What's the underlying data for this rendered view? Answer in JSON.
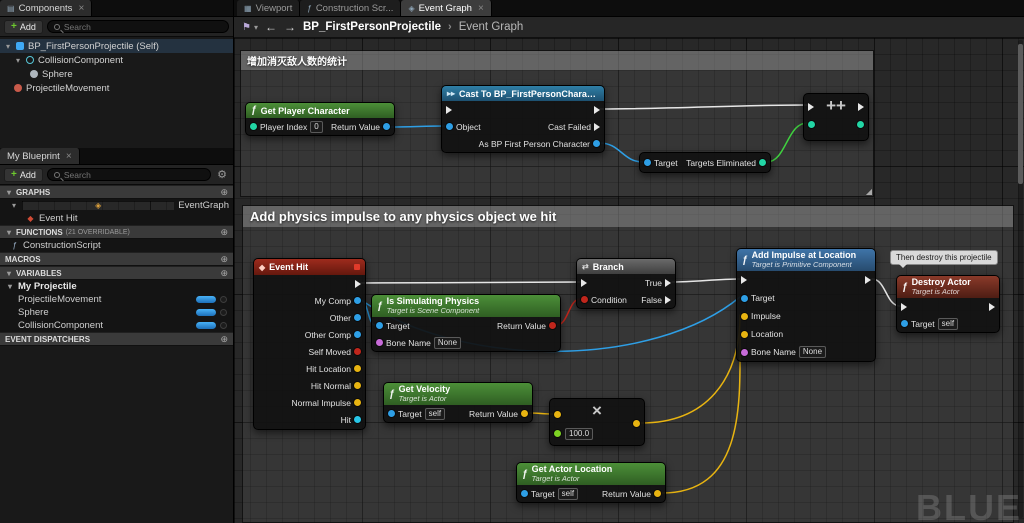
{
  "icons": {
    "components": "▤",
    "viewport": "▦",
    "graph": "◈",
    "close": "×",
    "caret_down": "▾",
    "caret_right": "▸",
    "add_circle": "⊕",
    "gear": "⚙",
    "function": "ƒ",
    "event_diamond": "◆",
    "branch": "⇄",
    "cast": "▸▸",
    "bookmark": "⚑",
    "back_arrow": "←",
    "forward_arrow": "→",
    "resize": "◢"
  },
  "components_panel": {
    "tab_label": "Components",
    "add_label": "Add",
    "search_placeholder": "Search",
    "items": [
      {
        "label": "BP_FirstPersonProjectile (Self)"
      },
      {
        "label": "CollisionComponent"
      },
      {
        "label": "Sphere"
      },
      {
        "label": "ProjectileMovement"
      }
    ]
  },
  "my_blueprint": {
    "tab_label": "My Blueprint",
    "add_label": "Add",
    "search_placeholder": "Search",
    "sections": {
      "graphs": "GRAPHS",
      "functions": "FUNCTIONS",
      "functions_badge": "(21 OVERRIDABLE)",
      "macros": "MACROS",
      "variables": "VARIABLES",
      "event_dispatchers": "EVENT DISPATCHERS"
    },
    "graph_items": [
      {
        "label": "EventGraph"
      },
      {
        "label": "Event Hit"
      }
    ],
    "function_items": [
      {
        "label": "ConstructionScript"
      }
    ],
    "variable_category": "My Projectile",
    "variable_items": [
      {
        "label": "ProjectileMovement"
      },
      {
        "label": "Sphere"
      },
      {
        "label": "CollisionComponent"
      }
    ]
  },
  "editor_tabs": [
    {
      "label": "Viewport"
    },
    {
      "label": "Construction Scr..."
    },
    {
      "label": "Event Graph"
    }
  ],
  "breadcrumb": {
    "root": "BP_FirstPersonProjectile",
    "separator": "›",
    "current": "Event Graph"
  },
  "comments": {
    "stats_title": "增加消灭敌人数的统计",
    "physics_title": "Add physics impulse to any physics object we hit",
    "bubble": "Then destroy this projectile"
  },
  "nodes": {
    "get_player_character": {
      "title": "Get Player Character",
      "player_index_label": "Player Index",
      "player_index_value": "0",
      "return_label": "Return Value"
    },
    "cast_to_character": {
      "title": "Cast To BP_FirstPersonCharacter",
      "object_label": "Object",
      "cast_failed_label": "Cast Failed",
      "as_label": "As BP First Person Character"
    },
    "increment": {
      "symbol": "++"
    },
    "targets_eliminated": {
      "target_label": "Target",
      "value_label": "Targets Eliminated"
    },
    "event_hit": {
      "title": "Event Hit",
      "pin_labels": [
        "My Comp",
        "Other",
        "Other Comp",
        "Self Moved",
        "Hit Location",
        "Hit Normal",
        "Normal Impulse",
        "Hit"
      ]
    },
    "is_simulating_physics": {
      "title": "Is Simulating Physics",
      "subtitle": "Target is Scene Component",
      "target_label": "Target",
      "bone_label": "Bone Name",
      "bone_value": "None",
      "return_label": "Return Value"
    },
    "branch": {
      "title": "Branch",
      "condition_label": "Condition",
      "true_label": "True",
      "false_label": "False"
    },
    "get_velocity": {
      "title": "Get Velocity",
      "subtitle": "Target is Actor",
      "target_label": "Target",
      "target_value": "self",
      "return_label": "Return Value"
    },
    "multiply": {
      "symbol": "×",
      "operand_value": "100.0"
    },
    "get_actor_location": {
      "title": "Get Actor Location",
      "subtitle": "Target is Actor",
      "target_label": "Target",
      "target_value": "self",
      "return_label": "Return Value"
    },
    "add_impulse_at_location": {
      "title": "Add Impulse at Location",
      "subtitle": "Target is Primitive Component",
      "target_label": "Target",
      "impulse_label": "Impulse",
      "location_label": "Location",
      "bone_label": "Bone Name",
      "bone_value": "None"
    },
    "destroy_actor": {
      "title": "Destroy Actor",
      "subtitle": "Target is Actor",
      "target_label": "Target",
      "target_value": "self"
    }
  },
  "watermark": "BLUE",
  "colors": {
    "exec_pin": "#e8e8e8",
    "object_pin": "#2e9fe6",
    "bool_pin": "#c0261c",
    "vector_pin": "#e8b411",
    "float_pin": "#7dd323",
    "int_pin": "#22d6a5",
    "name_pin": "#c76bd8",
    "struct_pin": "#28c7e8",
    "event_header": "#9e2b1d",
    "function_header": "#4c8f38",
    "cast_header": "#2f7fa6",
    "impure_header": "#3f74a8",
    "variable_pill": "#3fa9f5"
  }
}
